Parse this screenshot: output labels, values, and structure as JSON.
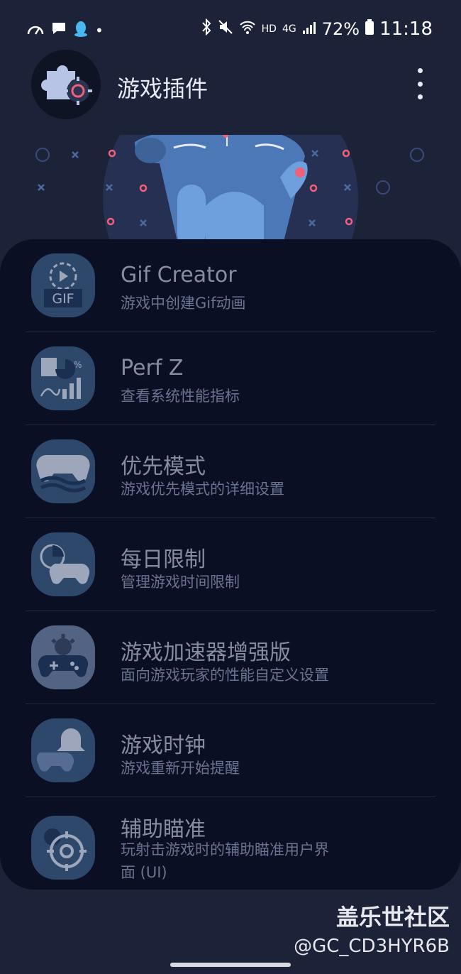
{
  "status_bar": {
    "battery": "72%",
    "time": "11:18",
    "hd": "HD",
    "network": "4G"
  },
  "app": {
    "title": "游戏插件"
  },
  "items": [
    {
      "title": "Gif Creator",
      "subtitle": "游戏中创建Gif动画",
      "icon": "gif-icon"
    },
    {
      "title": "Perf Z",
      "subtitle": "查看系统性能指标",
      "icon": "chart-icon"
    },
    {
      "title": "优先模式",
      "subtitle": "游戏优先模式的详细设置",
      "icon": "gamepad-waves-icon"
    },
    {
      "title": "每日限制",
      "subtitle": "管理游戏时间限制",
      "icon": "gamepad-timer-icon"
    },
    {
      "title": "游戏加速器增强版",
      "subtitle": "面向游戏玩家的性能自定义设置",
      "icon": "gamepad-gear-icon"
    },
    {
      "title": "游戏时钟",
      "subtitle": "游戏重新开始提醒",
      "icon": "bell-gamepad-icon"
    },
    {
      "title": "辅助瞄准",
      "subtitle": "玩射击游戏时的辅助瞄准用户界面 (UI)",
      "subtitle_line1": "玩射击游戏时的辅助瞄准用户界",
      "subtitle_line2": "面 (UI)",
      "icon": "crosshair-icon"
    }
  ],
  "watermark": {
    "line1": "盖乐世社区",
    "line2": "@GC_CD3HYR6B"
  },
  "colors": {
    "background": "#1c2238",
    "panel": "#0b0f23",
    "icon_bg": "#3a5c85",
    "accent_pink": "#f0607a"
  }
}
